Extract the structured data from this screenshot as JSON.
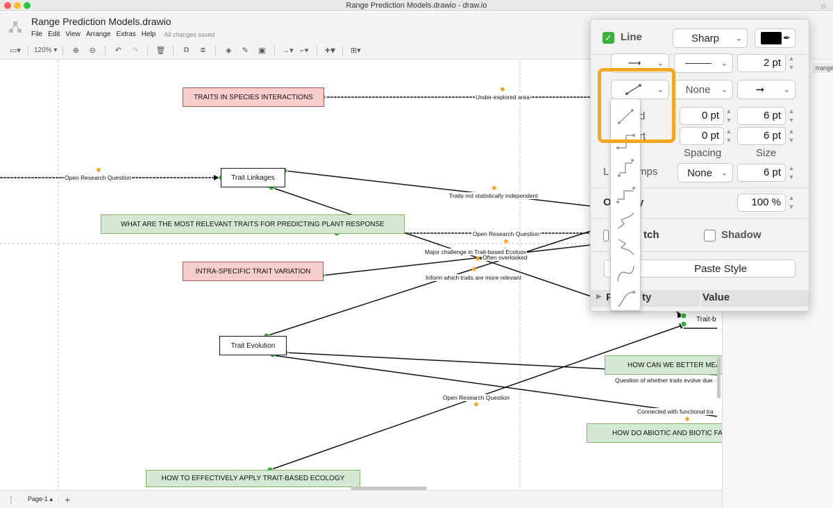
{
  "window": {
    "title": "Range Prediction Models.drawio - draw.io"
  },
  "app": {
    "filename": "Range Prediction Models.drawio",
    "menus": [
      "File",
      "Edit",
      "View",
      "Arrange",
      "Extras",
      "Help"
    ],
    "save_status": "All changes saved"
  },
  "toolbar": {
    "zoom": "120%",
    "icons": [
      "sidebar-toggle-icon",
      "zoom-in-icon",
      "zoom-out-icon",
      "undo-icon",
      "redo-icon",
      "delete-icon",
      "to-front-icon",
      "to-back-icon",
      "fill-color-icon",
      "line-color-icon",
      "shadow-icon",
      "connection-icon",
      "waypoints-icon",
      "insert-icon",
      "table-icon"
    ]
  },
  "canvas": {
    "nodes": [
      {
        "id": "traits-species",
        "label": "TRAITS IN SPECIES INTERACTIONS",
        "style": "red"
      },
      {
        "id": "trait-linkages",
        "label": "Trait Linkages",
        "style": "plain"
      },
      {
        "id": "most-relevant",
        "label": "WHAT ARE THE MOST RELEVANT TRAITS FOR PREDICTING PLANT RESPONSE",
        "style": "green"
      },
      {
        "id": "intra-specific",
        "label": "INTRA-SPECIFIC TRAIT VARIATION",
        "style": "red"
      },
      {
        "id": "trait-evolution",
        "label": "Trait Evolution",
        "style": "plain"
      },
      {
        "id": "measure",
        "label": "HOW CAN WE BETTER MEA",
        "style": "green"
      },
      {
        "id": "abiotic",
        "label": "HOW DO ABIOTIC AND BIOTIC FA",
        "style": "green"
      },
      {
        "id": "apply",
        "label": "HOW TO EFFECTIVELY APPLY TRAIT-BASED ECOLOGY",
        "style": "green"
      },
      {
        "id": "trait-b",
        "label": "Trait-b",
        "style": "plain"
      }
    ],
    "edge_labels": [
      "Under-explored area",
      "Open Research Question",
      "Traits not statistically independent",
      "Open Research Question",
      "Major challenge in Trait-based Ecology",
      "Often overlooked",
      "Inform which traits are more relevant",
      "Question of whether traits evolve due",
      "Connected with functional tra",
      "Open Research Question"
    ]
  },
  "right_panel": {
    "tab": "rrange"
  },
  "bottom": {
    "page": "Page-1"
  },
  "format_popup": {
    "line": {
      "checked": true,
      "label": "Line",
      "style_value": "Sharp",
      "color": "#000000"
    },
    "row2": {
      "pattern": "solid",
      "width": "2 pt"
    },
    "row3": {
      "waypoint_style": "straight",
      "line_start": "None",
      "line_end": "arrow"
    },
    "line_end_label_visible": "d",
    "line_start_label_visible": "rt",
    "line_end": {
      "spacing": "0 pt",
      "size": "6 pt"
    },
    "line_start": {
      "spacing": "0 pt",
      "size": "6 pt"
    },
    "col_spacing": "Spacing",
    "col_size": "Size",
    "line_jumps": {
      "label_visible": "mps",
      "value": "None",
      "size": "6 pt"
    },
    "opacity": {
      "label_visible": "y",
      "value": "100 %"
    },
    "sketch_label_visible": "tch",
    "shadow": {
      "checked": false,
      "label": "Shadow"
    },
    "paste_style": "Paste Style",
    "property_table": {
      "col1_visible": "ty",
      "col2": "Value"
    }
  },
  "waypoint_menu": {
    "items": [
      "straight",
      "orthogonal",
      "simple",
      "isometric",
      "curved-isometric",
      "curved",
      "entity-relation"
    ]
  },
  "colors": {
    "accent_highlight": "#f5a623",
    "checkbox_green": "#3cae3c",
    "red_fill": "#f8cecc",
    "red_border": "#b85450",
    "green_fill": "#d5e8d4",
    "green_border": "#82b366"
  }
}
